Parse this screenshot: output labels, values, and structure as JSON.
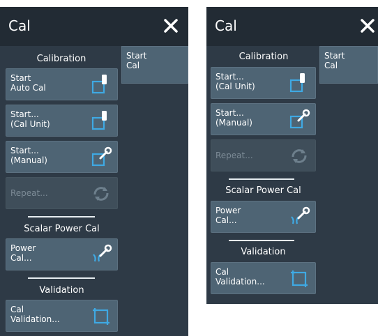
{
  "colors": {
    "panel_bg": "#2e3a46",
    "header_bg": "#222b34",
    "button_bg": "#4e6474",
    "icon_blue": "#3fa9e3",
    "disabled_text": "#7c8b96"
  },
  "left_panel": {
    "title": "Cal",
    "close_icon": "close-icon",
    "side_tab": "Start\nCal",
    "sections": {
      "calibration": "Calibration",
      "scalar_power_cal": "Scalar Power Cal",
      "validation": "Validation"
    },
    "buttons": {
      "start_auto_cal": "Start\nAuto Cal",
      "start_cal_unit": "Start...\n(Cal Unit)",
      "start_manual": "Start...\n(Manual)",
      "repeat": "Repeat...",
      "power_cal": "Power\nCal...",
      "cal_validation": "Cal\nValidation..."
    }
  },
  "right_panel": {
    "title": "Cal",
    "close_icon": "close-icon",
    "side_tab": "Start\nCal",
    "sections": {
      "calibration": "Calibration",
      "scalar_power_cal": "Scalar Power Cal",
      "validation": "Validation"
    },
    "buttons": {
      "start_cal_unit": "Start...\n(Cal Unit)",
      "start_manual": "Start...\n(Manual)",
      "repeat": "Repeat...",
      "power_cal": "Power\nCal...",
      "cal_validation": "Cal\nValidation..."
    }
  }
}
